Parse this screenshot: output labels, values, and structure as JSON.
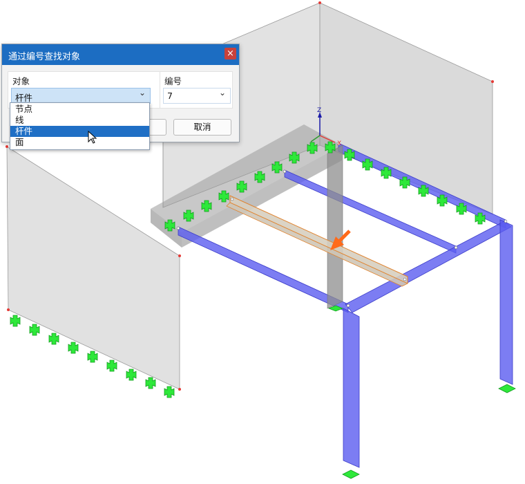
{
  "dialog": {
    "title": "通过编号查找对象",
    "close_glyph": "×",
    "object_label": "对象",
    "object_value": "杆件",
    "number_label": "编号",
    "number_value": "7",
    "cancel_label": "取消"
  },
  "dropdown": {
    "options": [
      "节点",
      "线",
      "杆件",
      "面"
    ],
    "selected_index": 2
  },
  "viewport": {
    "axis_labels": {
      "z": "Z",
      "x": "X"
    },
    "colors": {
      "member": "#5b5cf0",
      "support": "#2ee83a",
      "surface": "#9e9e9e",
      "highlight": "#ff6a1a"
    }
  }
}
